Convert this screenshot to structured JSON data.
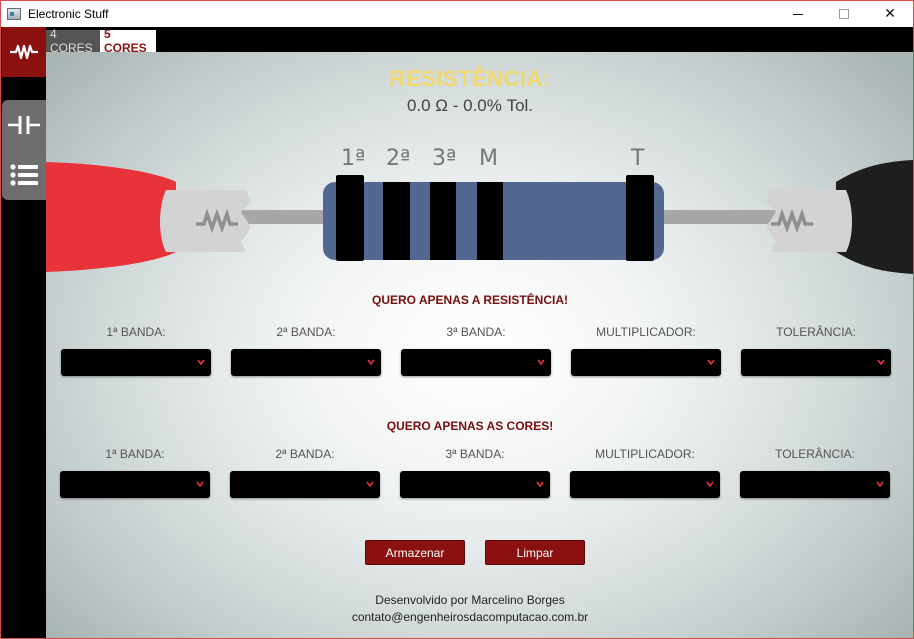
{
  "window": {
    "title": "Electronic Stuff",
    "close_symbol": "✕"
  },
  "sidebar": {
    "items": [
      {
        "icon": "resistor-icon",
        "active": true
      },
      {
        "icon": "capacitor-icon",
        "active": false
      },
      {
        "icon": "list-icon",
        "active": false
      }
    ]
  },
  "tabs": [
    {
      "label": "4 CORES",
      "selected": false
    },
    {
      "label": "5 CORES",
      "selected": true
    }
  ],
  "header": {
    "title": "RESISTÊNCIA:",
    "value": "0.0 Ω - 0.0% Tol."
  },
  "resistor": {
    "band_labels": [
      "1ª",
      "2ª",
      "3ª",
      "M",
      "T"
    ]
  },
  "section_resistance": {
    "title": "QUERO APENAS A RESISTÊNCIA!",
    "fields": [
      "1ª BANDA:",
      "2ª BANDA:",
      "3ª BANDA:",
      "MULTIPLICADOR:",
      "TOLERÂNCIA:"
    ]
  },
  "section_colors": {
    "title": "QUERO APENAS AS CORES!",
    "fields": [
      "1ª BANDA:",
      "2ª BANDA:",
      "3ª BANDA:",
      "MULTIPLICADOR:",
      "TOLERÂNCIA:"
    ]
  },
  "buttons": {
    "store": "Armazenar",
    "clear": "Limpar"
  },
  "footer": {
    "line1": "Desenvolvido por Marcelino Borges",
    "line2": "contato@engenheirosdacomputacao.com.br"
  },
  "colors": {
    "accent": "#8b1010",
    "title_yellow": "#f2d86a",
    "resistor_body": "#536890",
    "lead_red": "#e8333a"
  }
}
